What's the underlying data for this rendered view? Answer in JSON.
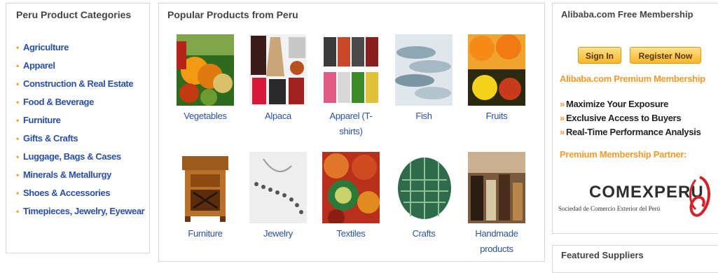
{
  "categories": {
    "title": "Peru Product Categories",
    "items": [
      "Agriculture",
      "Apparel",
      "Construction & Real Estate",
      "Food & Beverage",
      "Furniture",
      "Gifts & Crafts",
      "Luggage, Bags & Cases",
      "Minerals & Metallurgy",
      "Shoes & Accessories",
      "Timepieces, Jewelry, Eyewear"
    ]
  },
  "popular": {
    "title": "Popular Products from Peru",
    "products": [
      {
        "label": "Vegetables"
      },
      {
        "label": "Alpaca"
      },
      {
        "label": "Apparel (T-shirts)"
      },
      {
        "label": "Fish"
      },
      {
        "label": "Fruits"
      },
      {
        "label": "Furniture"
      },
      {
        "label": "Jewelry"
      },
      {
        "label": "Textiles"
      },
      {
        "label": "Crafts"
      },
      {
        "label": "Handmade products"
      }
    ]
  },
  "membership": {
    "title": "Alibaba.com Free Membership",
    "sign_in": "Sign In",
    "register": "Register Now",
    "premium_link": "Alibaba.com Premium Membership",
    "benefits": [
      "Maximize Your Exposure",
      "Exclusive Access to Buyers",
      "Real-Time Performance Analysis"
    ],
    "partner_label": "Premium Membership Partner:",
    "partner_name": "COMEXPERU",
    "partner_sub": "Sociedad de Comercio Exterior del Perú"
  },
  "featured": {
    "title": "Featured Suppliers"
  },
  "colors": {
    "link_blue": "#2a4fa8",
    "accent_orange": "#f39a2a",
    "button_gold": "#f6b829"
  }
}
